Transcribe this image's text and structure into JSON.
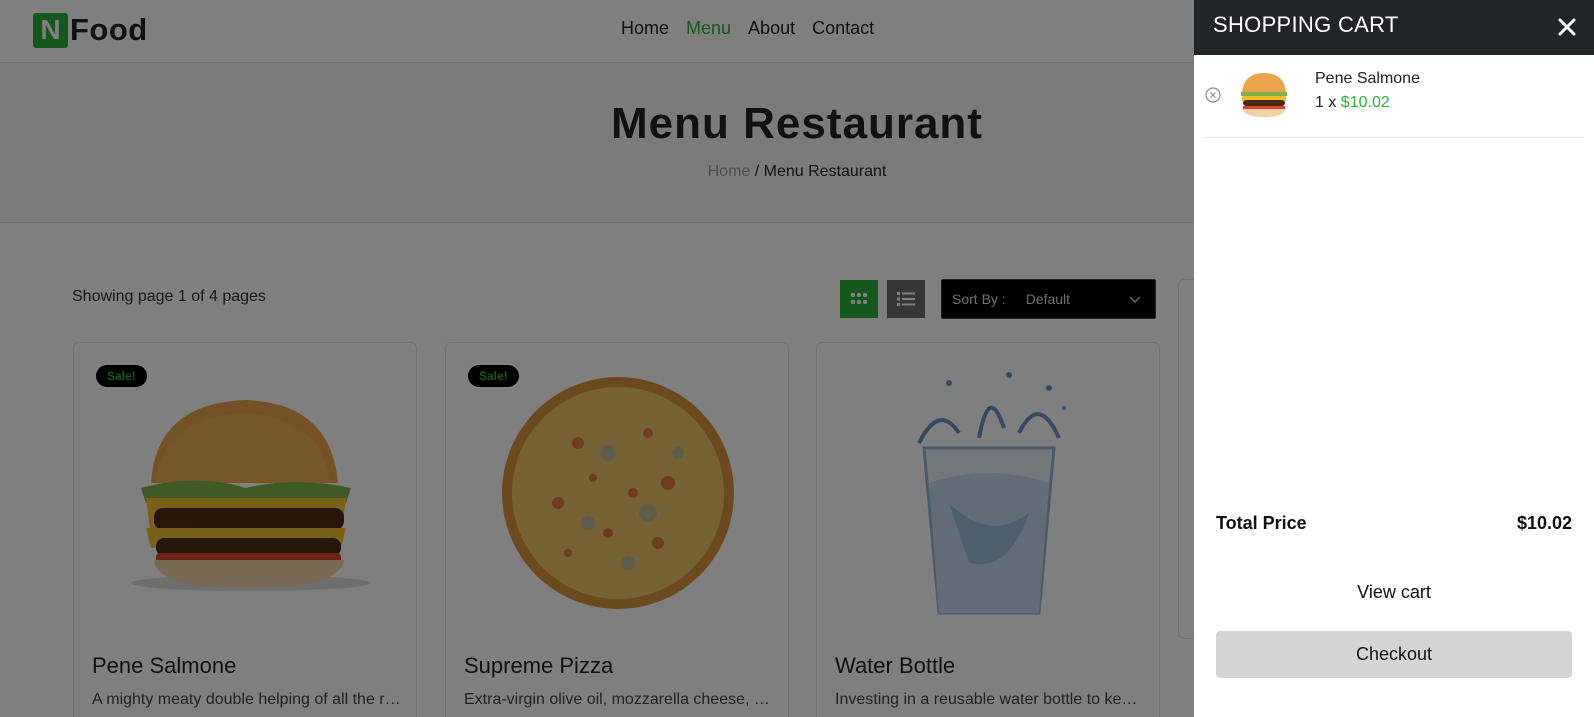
{
  "brand": {
    "logo_letter": "N",
    "logo_text": "Food",
    "accent": "#2bb13a"
  },
  "nav": {
    "items": [
      "Home",
      "Menu",
      "About",
      "Contact"
    ],
    "active": "Menu"
  },
  "hero": {
    "title": "Menu Restaurant",
    "crumb_home": "Home",
    "crumb_sep": " / ",
    "crumb_current": "Menu Restaurant"
  },
  "toolbar": {
    "showing": "Showing page 1 of 4 pages",
    "sort_label": "Sort By :",
    "sort_value": "Default"
  },
  "products": [
    {
      "badge": "Sale!",
      "title": "Pene Salmone",
      "desc": "A mighty meaty double helping of all the reasons you love our burger.",
      "image": "burger-image"
    },
    {
      "badge": "Sale!",
      "title": "Supreme Pizza",
      "desc": "Extra-virgin olive oil, mozzarella cheese, oregano and tomatoes.",
      "image": "pizza-image"
    },
    {
      "badge": "",
      "title": "Water Bottle",
      "desc": "Investing in a reusable water bottle to keep you hydrated.",
      "image": "water-glass-image"
    }
  ],
  "cart": {
    "title": "SHOPPING CART",
    "items": [
      {
        "name": "Pene Salmone",
        "qty_prefix": "1 x ",
        "price": "$10.02",
        "image": "burger-thumbnail"
      }
    ],
    "total_label": "Total Price",
    "total_value": "$10.02",
    "view_cart": "View cart",
    "checkout": "Checkout"
  }
}
